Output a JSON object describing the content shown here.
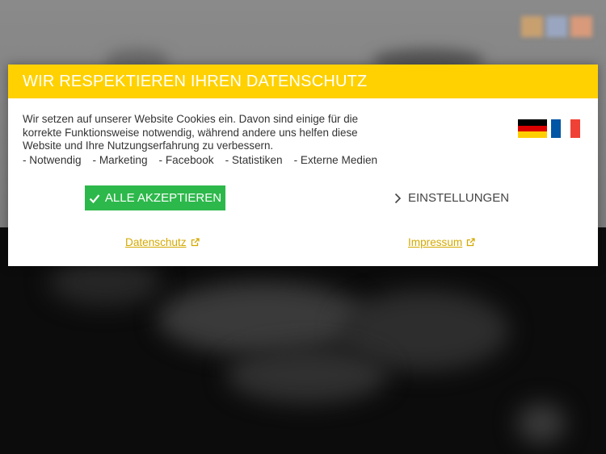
{
  "dialog": {
    "title": "WIR RESPEKTIEREN IHREN DATENSCHUTZ",
    "intro": "Wir setzen auf unserer Website Cookies ein. Davon sind einige für die korrekte Funktionsweise notwendig, während andere uns helfen diese Website und Ihre Nutzungserfahrung zu verbessern.",
    "categories": [
      "- Notwendig",
      "- Marketing",
      "- Facebook",
      "- Statistiken",
      "- Externe Medien"
    ],
    "accept_label": "ALLE AKZEPTIEREN",
    "settings_label": "EINSTELLUNGEN",
    "privacy_link": "Datenschutz",
    "imprint_link": "Impressum",
    "languages": [
      "de",
      "fr"
    ]
  },
  "colors": {
    "header": "#ffd100",
    "accept": "#2db84b",
    "link": "#d4a900"
  },
  "icons": {
    "accept": "check-icon",
    "settings": "chevron-right-icon",
    "external": "external-link-icon"
  }
}
